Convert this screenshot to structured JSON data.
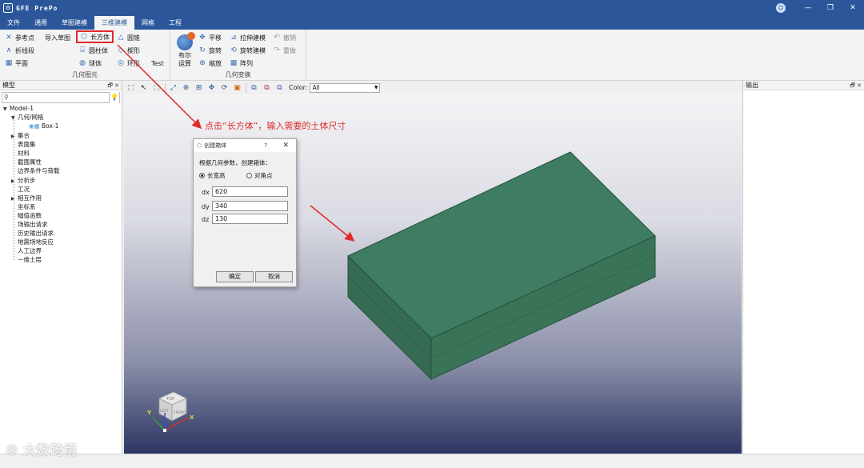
{
  "app": {
    "title": "GFE PrePo",
    "logo": "⚙"
  },
  "window": {
    "user_icon": "user-avatar-icon"
  },
  "menu": {
    "tabs": [
      "文件",
      "通用",
      "草图建模",
      "三维建模",
      "网格",
      "工程"
    ],
    "active": "三维建模"
  },
  "ribbon": {
    "group1": {
      "label": "几何图元",
      "items": {
        "ref_point": "参考点",
        "import_sketch": "导入草图",
        "polyline": "折线段",
        "plane": "平面",
        "box": "长方体",
        "cylinder": "圆柱体",
        "sphere": "球体",
        "cone": "圆锥",
        "wedge": "楔形",
        "torus": "环形",
        "test": "Test"
      }
    },
    "group2": {
      "label": "几何变换",
      "items": {
        "boolean": "布尔运算",
        "translate": "平移",
        "rotate": "旋转",
        "scale": "缩放",
        "extrude": "拉伸建模",
        "revolve": "旋转建模",
        "array": "阵列",
        "undo": "撤销",
        "redo": "重做"
      }
    }
  },
  "left_panel": {
    "title": "模型",
    "tree": {
      "root": "Model-1",
      "geometry": "几何/网格",
      "box": "Box-1",
      "items": [
        "集合",
        "表面集",
        "材料",
        "截面属性",
        "边界条件与荷载",
        "分析步",
        "工况",
        "相互作用",
        "坐标系",
        "幅值函数",
        "场输出请求",
        "历史输出请求",
        "地震场地反应",
        "人工边界",
        "一维土层"
      ]
    }
  },
  "viewport_toolbar": {
    "color_label": "Color:",
    "color_value": "All"
  },
  "right_panel": {
    "title": "输出"
  },
  "annotation": "点击“长方体”，输入需要的土体尺寸",
  "dialog": {
    "title": "创建箱体",
    "help": "?",
    "description": "根据几何参数，创建箱体：",
    "radio_options": [
      "长宽高",
      "对角点"
    ],
    "selected_radio": "长宽高",
    "fields": {
      "dx_label": "dx",
      "dx": "620",
      "dy_label": "dy",
      "dy": "340",
      "dz_label": "dz",
      "dz": "130"
    },
    "ok": "确定",
    "cancel": "取消"
  },
  "view_cube": {
    "top": "TOP",
    "front": "FRONT",
    "left": "LEFT",
    "x": "X",
    "y": "Y"
  },
  "watermark": "大数跨境",
  "colors": {
    "accent": "#2b579a",
    "model_fill": "#3b7a5f",
    "highlight": "#e02a2a"
  }
}
